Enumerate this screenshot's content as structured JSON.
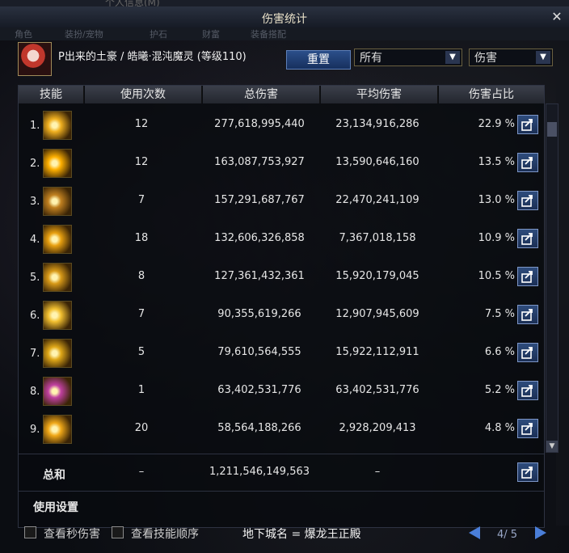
{
  "window": {
    "title": "伤害统计",
    "bg_title": "个人信息(M)"
  },
  "bg_tabs": [
    "角色",
    "装扮/宠物",
    "护石",
    "财富",
    "装备搭配"
  ],
  "header": {
    "character": "P出来的土豪 / 皓曦·混沌魔灵 (等级110)",
    "reset_label": "重置",
    "filter_select": "所有",
    "mode_select": "伤害"
  },
  "columns": [
    "技能",
    "使用次数",
    "总伤害",
    "平均伤害",
    "伤害占比"
  ],
  "rows": [
    {
      "rank": "1.",
      "uses": "12",
      "total": "277,618,995,440",
      "avg": "23,134,916,286",
      "pct": "22.9 %",
      "icon_color": "#f0b020"
    },
    {
      "rank": "2.",
      "uses": "12",
      "total": "163,087,753,927",
      "avg": "13,590,646,160",
      "pct": "13.5 %",
      "icon_color": "#ffb000"
    },
    {
      "rank": "3.",
      "uses": "7",
      "total": "157,291,687,767",
      "avg": "22,470,241,109",
      "pct": "13.0 %",
      "icon_color": "#c08020"
    },
    {
      "rank": "4.",
      "uses": "18",
      "total": "132,606,326,858",
      "avg": "7,367,018,158",
      "pct": "10.9 %",
      "icon_color": "#e8a010"
    },
    {
      "rank": "5.",
      "uses": "8",
      "total": "127,361,432,361",
      "avg": "15,920,179,045",
      "pct": "10.5 %",
      "icon_color": "#d89a18"
    },
    {
      "rank": "6.",
      "uses": "7",
      "total": "90,355,619,266",
      "avg": "12,907,945,609",
      "pct": "7.5 %",
      "icon_color": "#f2c030"
    },
    {
      "rank": "7.",
      "uses": "5",
      "total": "79,610,564,555",
      "avg": "15,922,112,911",
      "pct": "6.6 %",
      "icon_color": "#e0a818"
    },
    {
      "rank": "8.",
      "uses": "1",
      "total": "63,402,531,776",
      "avg": "63,402,531,776",
      "pct": "5.2 %",
      "icon_color": "#c040a0"
    },
    {
      "rank": "9.",
      "uses": "20",
      "total": "58,564,188,266",
      "avg": "2,928,209,413",
      "pct": "4.8 %",
      "icon_color": "#f0a818"
    }
  ],
  "summary": {
    "label": "总和",
    "uses": "–",
    "total": "1,211,546,149,563",
    "avg": "–"
  },
  "settings_label": "使用设置",
  "footer": {
    "check_per_second": "查看秒伤害",
    "check_order": "查看技能顺序",
    "dungeon": "地下城名 = 爆龙王正殿",
    "page": "4/ 5"
  }
}
